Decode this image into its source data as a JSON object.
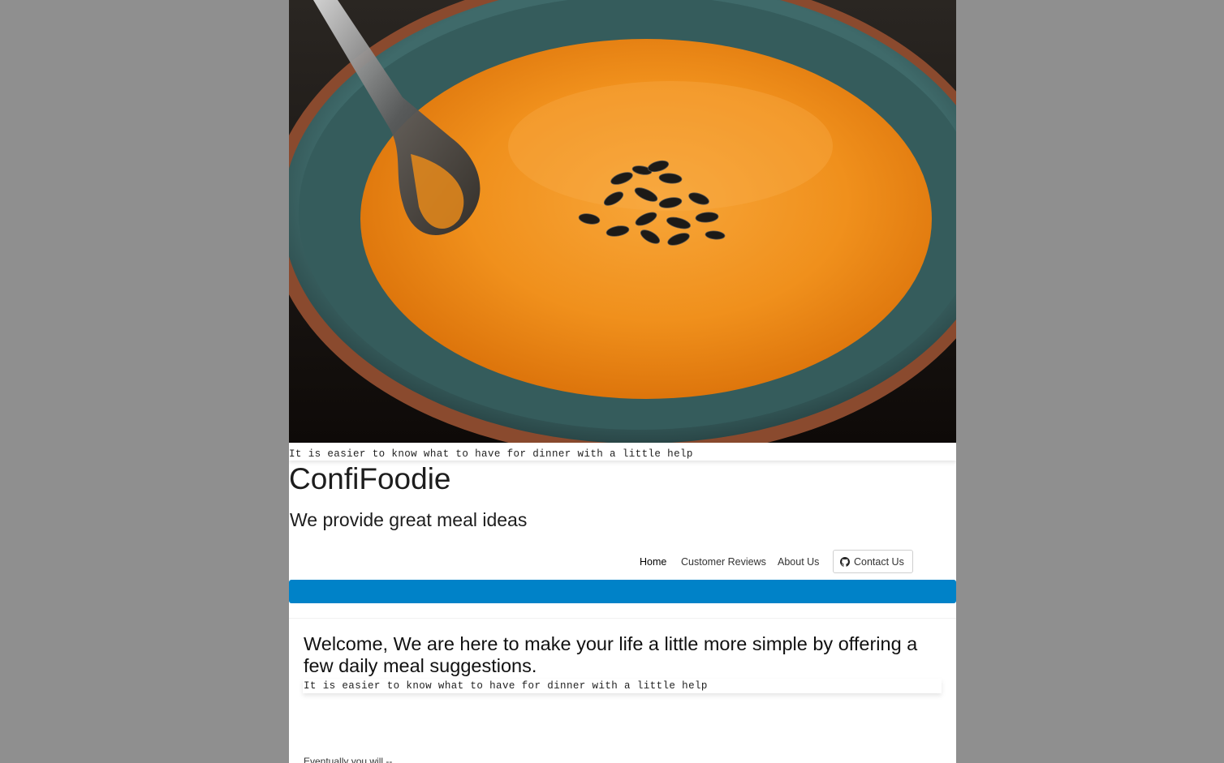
{
  "hero": {
    "image_subject": "bowl of orange soup with spoon and seeds",
    "caption": "It is easier to know what to have for dinner with a little help"
  },
  "site": {
    "title": "ConfiFoodie",
    "tagline": "We provide great meal ideas"
  },
  "nav": {
    "items": [
      {
        "label": "Home",
        "active": true
      },
      {
        "label": "Customer Reviews",
        "active": false
      },
      {
        "label": "About Us",
        "active": false
      }
    ],
    "contact_label": "Contact Us",
    "contact_icon": "github-icon"
  },
  "colors": {
    "accent_bar": "#0082c8",
    "outer_background": "#8f8f8f"
  },
  "main": {
    "welcome": "Welcome, We are here to make your life a little more simple by offering a few daily meal suggestions.",
    "caption": "It is easier to know what to have for dinner with a little help",
    "footer_text": "Eventually you will --"
  }
}
